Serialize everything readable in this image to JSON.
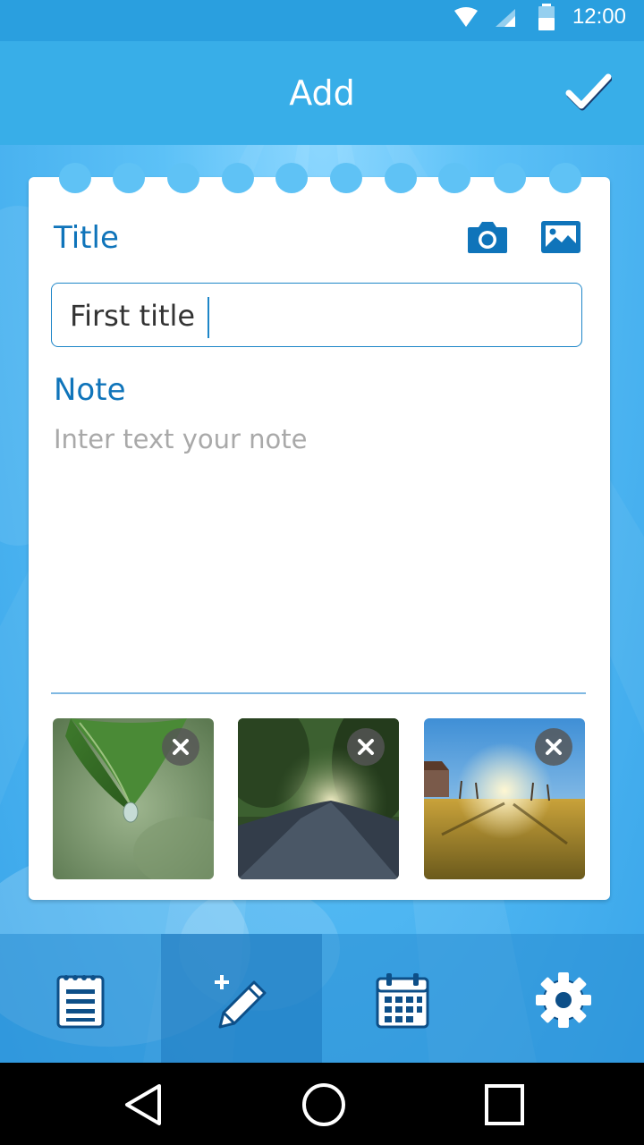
{
  "status_bar": {
    "time": "12:00"
  },
  "app_bar": {
    "title": "Add",
    "confirm_icon": "checkmark-icon"
  },
  "form": {
    "title_label": "Title",
    "title_value": "First title",
    "note_label": "Note",
    "note_placeholder": "Inter text your note",
    "camera_icon": "camera-icon",
    "gallery_icon": "image-icon"
  },
  "attachments": [
    {
      "name": "leaf-water-drop-photo",
      "remove_icon": "close-icon"
    },
    {
      "name": "tree-lined-road-photo",
      "remove_icon": "close-icon"
    },
    {
      "name": "sunset-field-photo",
      "remove_icon": "close-icon"
    }
  ],
  "tabs": [
    {
      "icon": "notepad-icon",
      "active": false
    },
    {
      "icon": "add-note-pencil-icon",
      "active": true
    },
    {
      "icon": "calendar-icon",
      "active": false
    },
    {
      "icon": "gear-icon",
      "active": false
    }
  ],
  "navigation": [
    "back-icon",
    "home-icon",
    "recents-icon"
  ],
  "colors": {
    "accent": "#0f74ba",
    "app_bar": "#38aee8",
    "background": "#4fb7f3"
  }
}
